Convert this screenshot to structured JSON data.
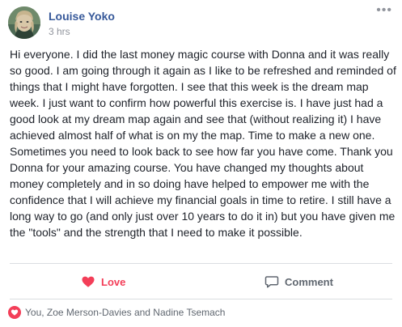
{
  "post": {
    "author_name": "Louise Yoko",
    "timestamp": "3 hrs",
    "text": "Hi everyone. I did the last money magic course with Donna and it was really so good. I am going through it again as I like to be refreshed and reminded of things that I might have forgotten. I see that this week is the dream map week. I just want to confirm how powerful this exercise is. I have just had a good look at my dream map again and see that (without realizing it) I have achieved almost half of what is on my the map. Time to make a new one. Sometimes you need to look back to see how far you have come. Thank you Donna for your amazing course. You have changed my thoughts about money completely and in so doing have helped to empower me with the confidence that I will achieve my financial goals in time to retire. I still have a long way to go (and only just over 10 years to do it in) but you have given me the \"tools\" and the strength that I need to make it possible."
  },
  "actions": {
    "love_label": "Love",
    "comment_label": "Comment"
  },
  "reactions": {
    "summary": "You, Zoe Merson-Davies and Nadine Tsemach"
  },
  "colors": {
    "author_link": "#365899",
    "love_accent": "#f33e58",
    "muted_text": "#90949c",
    "action_text": "#606770"
  },
  "icons": {
    "avatar": "avatar",
    "more": "more-options-icon",
    "love": "heart-icon",
    "comment": "comment-bubble-icon",
    "reaction_badge": "heart-reaction-icon"
  }
}
